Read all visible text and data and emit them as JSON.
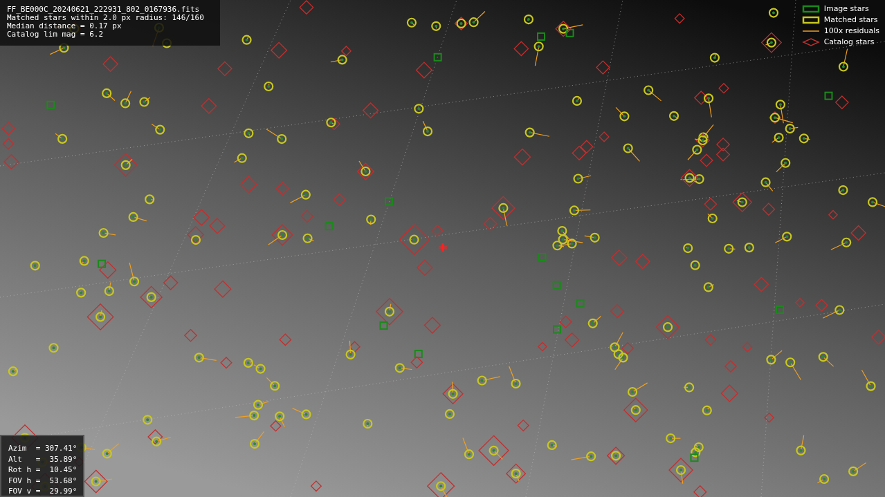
{
  "info_box": {
    "lines": [
      "FF_BE000C_20240621_222931_802_0167936.fits",
      "Matched stars within 2.0 px radius: 146/160",
      "Median distance = 0.17 px",
      "Catalog lim mag = 6.2"
    ]
  },
  "legend": {
    "items": [
      {
        "label": "Image stars",
        "kind": "image"
      },
      {
        "label": "Matched stars",
        "kind": "matched"
      },
      {
        "label": "100x residuals",
        "kind": "residual"
      },
      {
        "label": "Catalog stars",
        "kind": "catalog"
      }
    ]
  },
  "pointing_box": {
    "lines": [
      "Azim  = 307.41°",
      "Alt   =  35.89°",
      "Rot h =  10.45°",
      "FOV h =  53.68°",
      "FOV v =  29.99°"
    ]
  }
}
